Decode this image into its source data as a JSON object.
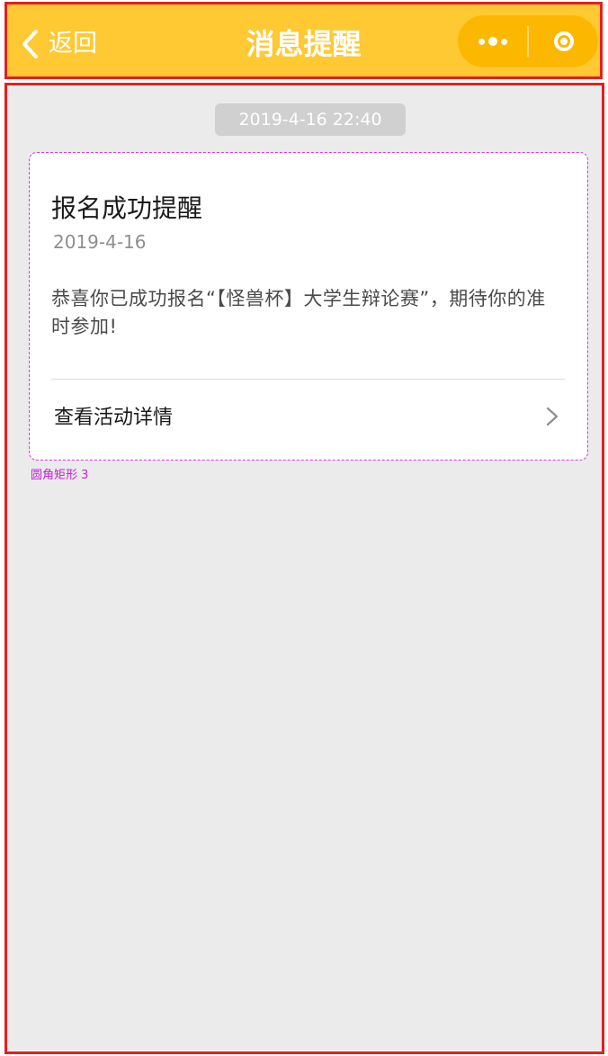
{
  "header": {
    "back_label": "返回",
    "title": "消息提醒",
    "back_icon": "chevron-left-icon",
    "more_icon": "more-dots-icon",
    "close_icon": "target-icon"
  },
  "timestamp": "2019-4-16  22:40",
  "card": {
    "title": "报名成功提醒",
    "date": "2019-4-16",
    "body": "恭喜你已成功报名“【怪兽杯】大学生辩论赛”，期待你的准时参加!",
    "link_label": "查看活动详情",
    "link_icon": "chevron-right-icon"
  },
  "annotation": "圆角矩形 3",
  "colors": {
    "header_bg": "#FFC933",
    "capsule_bg": "#FCB801",
    "page_bg": "#EBEBEB",
    "outline_red": "#E02020",
    "annotation_magenta": "#C420D6"
  }
}
